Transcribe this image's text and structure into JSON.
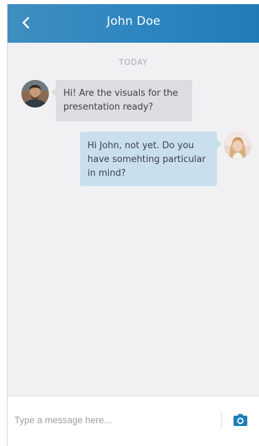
{
  "header": {
    "title": "John Doe",
    "back_icon": "chevron-left-icon",
    "background_from": "#3f8ec0",
    "background_to": "#237bb6"
  },
  "conversation": {
    "date_separator": "TODAY",
    "messages": [
      {
        "sender": "John Doe",
        "direction": "incoming",
        "lines": [
          "Hi! Are the visuals for the",
          "presentation ready?"
        ],
        "bubble_color": "#dcdde1"
      },
      {
        "sender": "me",
        "direction": "outgoing",
        "lines": [
          "Hi John, not yet. Do you",
          "have somehting particular",
          "in mind?"
        ],
        "bubble_color": "#c9dfee"
      }
    ]
  },
  "composer": {
    "placeholder": "Type a message here...",
    "value": "",
    "camera_icon": "camera-icon",
    "accent": "#1f7db8"
  }
}
